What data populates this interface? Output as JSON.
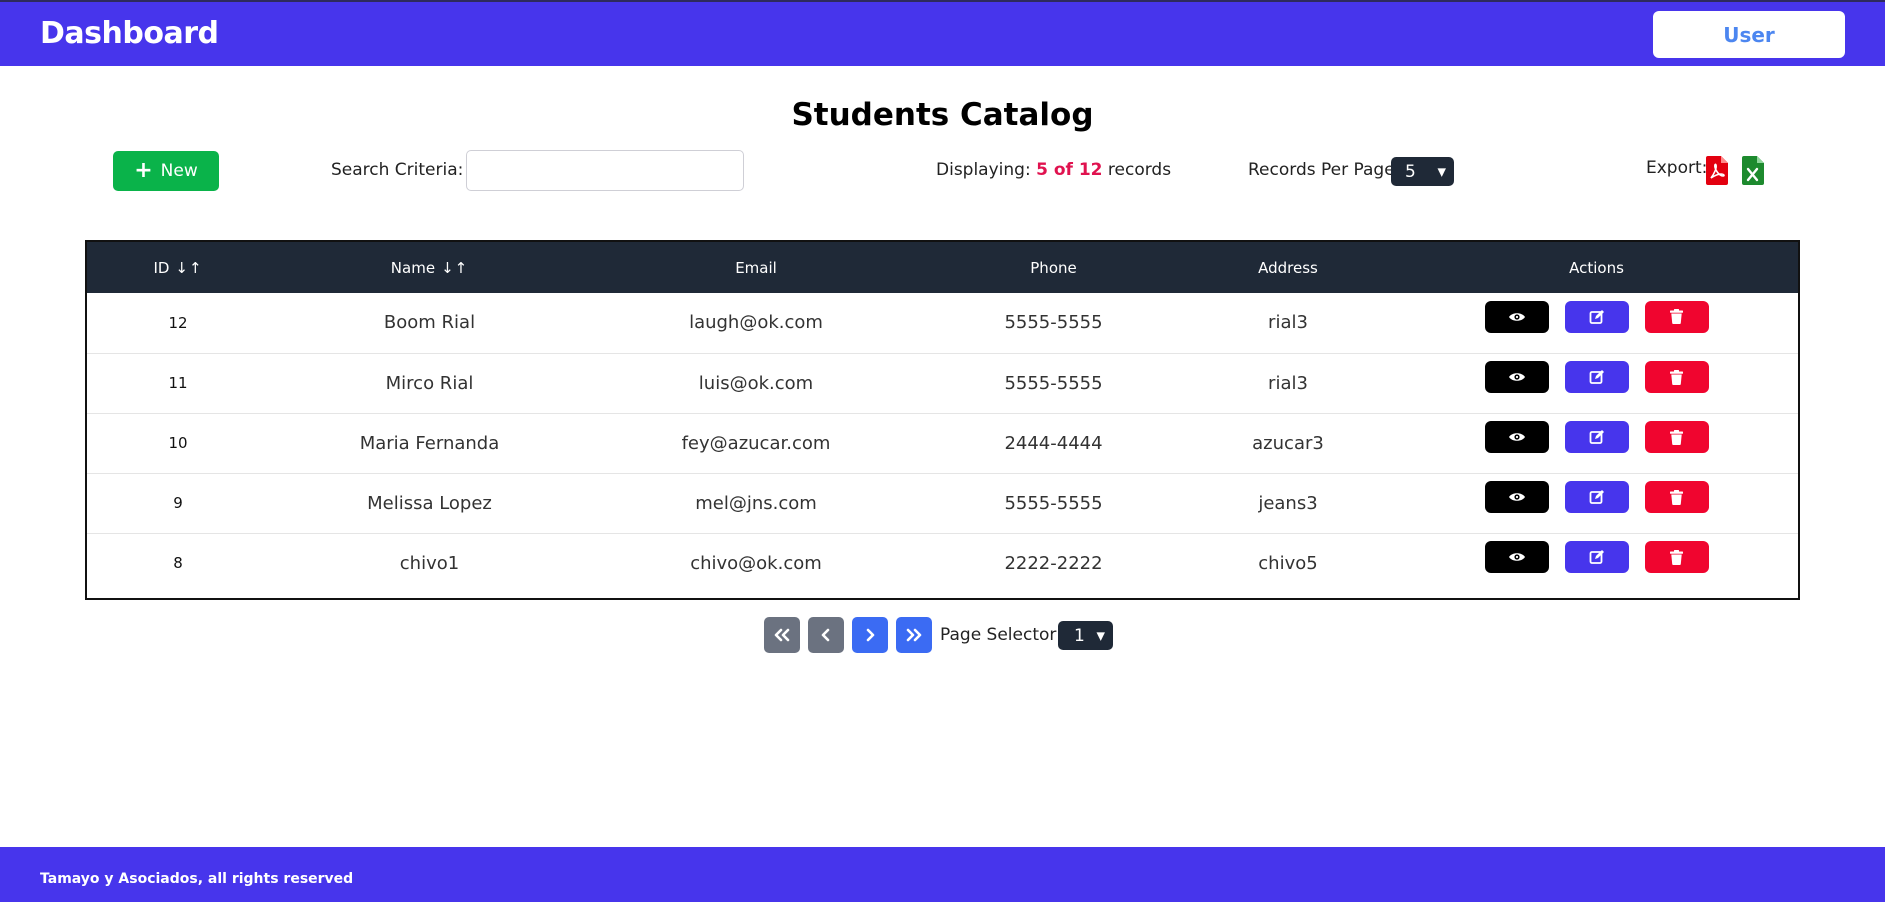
{
  "header": {
    "brand": "Dashboard",
    "user_label": "User"
  },
  "page": {
    "title": "Students Catalog"
  },
  "toolbar": {
    "new_label": "New",
    "search_label": "Search Criteria:",
    "search_value": "",
    "displaying_prefix": "Displaying:",
    "displaying_count": "5 of 12",
    "displaying_suffix": "records",
    "records_per_page_label": "Records Per Page:",
    "records_per_page_value": "5",
    "export_label": "Export:"
  },
  "table": {
    "columns": [
      "ID",
      "Name",
      "Email",
      "Phone",
      "Address",
      "Actions"
    ],
    "rows": [
      {
        "id": "12",
        "name": "Boom Rial",
        "email": "laugh@ok.com",
        "phone": "5555-5555",
        "address": "rial3"
      },
      {
        "id": "11",
        "name": "Mirco Rial",
        "email": "luis@ok.com",
        "phone": "5555-5555",
        "address": "rial3"
      },
      {
        "id": "10",
        "name": "Maria Fernanda",
        "email": "fey@azucar.com",
        "phone": "2444-4444",
        "address": "azucar3"
      },
      {
        "id": "9",
        "name": "Melissa Lopez",
        "email": "mel@jns.com",
        "phone": "5555-5555",
        "address": "jeans3"
      },
      {
        "id": "8",
        "name": "chivo1",
        "email": "chivo@ok.com",
        "phone": "2222-2222",
        "address": "chivo5"
      }
    ]
  },
  "pager": {
    "page_selector_label": "Page Selector:",
    "page_value": "1"
  },
  "footer": {
    "text": "Tamayo y Asociados, all rights reserved"
  },
  "colors": {
    "primary": "#4735ec",
    "success": "#0ab34a",
    "danger": "#f0052f",
    "dark": "#1f2937",
    "highlight": "#e0124f",
    "pdf": "#e3000f",
    "excel": "#1d8a2e"
  },
  "icons": {
    "view": "eye-icon",
    "edit": "edit-icon",
    "delete": "trash-icon",
    "pdf": "file-pdf-icon",
    "excel": "file-excel-icon"
  }
}
